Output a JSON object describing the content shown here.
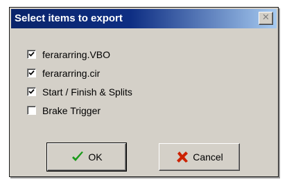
{
  "dialog": {
    "title": "Select items to export",
    "close_glyph": "✕"
  },
  "items": [
    {
      "label": "ferararring.VBO",
      "checked": true
    },
    {
      "label": "ferararring.cir",
      "checked": true
    },
    {
      "label": "Start / Finish & Splits",
      "checked": true
    },
    {
      "label": "Brake Trigger",
      "checked": false
    }
  ],
  "buttons": {
    "ok": {
      "label": "OK",
      "icon": "checkmark-icon",
      "icon_color": "#1a9a1a"
    },
    "cancel": {
      "label": "Cancel",
      "icon": "x-cross-icon",
      "icon_color": "#cc2200"
    }
  }
}
